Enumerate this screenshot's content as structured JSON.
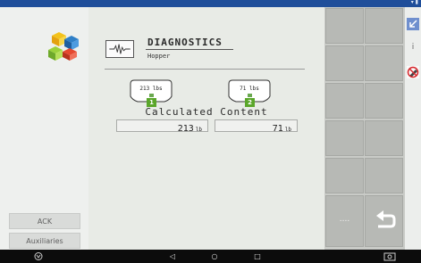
{
  "left_panel": {
    "ack_label": "ACK",
    "auxiliaries_label": "Auxiliaries"
  },
  "main": {
    "title": "DIAGNOSTICS",
    "subtitle": "Hopper",
    "bins": [
      {
        "value_label": "213 lbs",
        "badge": "1"
      },
      {
        "value_label": "71 lbs",
        "badge": "2"
      }
    ],
    "calculated_title": "Calculated Content",
    "values": [
      {
        "number": "213",
        "unit": "lb"
      },
      {
        "number": "71",
        "unit": "lb"
      }
    ]
  },
  "softkeys": {
    "more_label": "...."
  },
  "colors": {
    "statusbar": "#1f4e9a",
    "accent_green": "#5aa62a",
    "softkey_bg": "#c9cbc7"
  }
}
